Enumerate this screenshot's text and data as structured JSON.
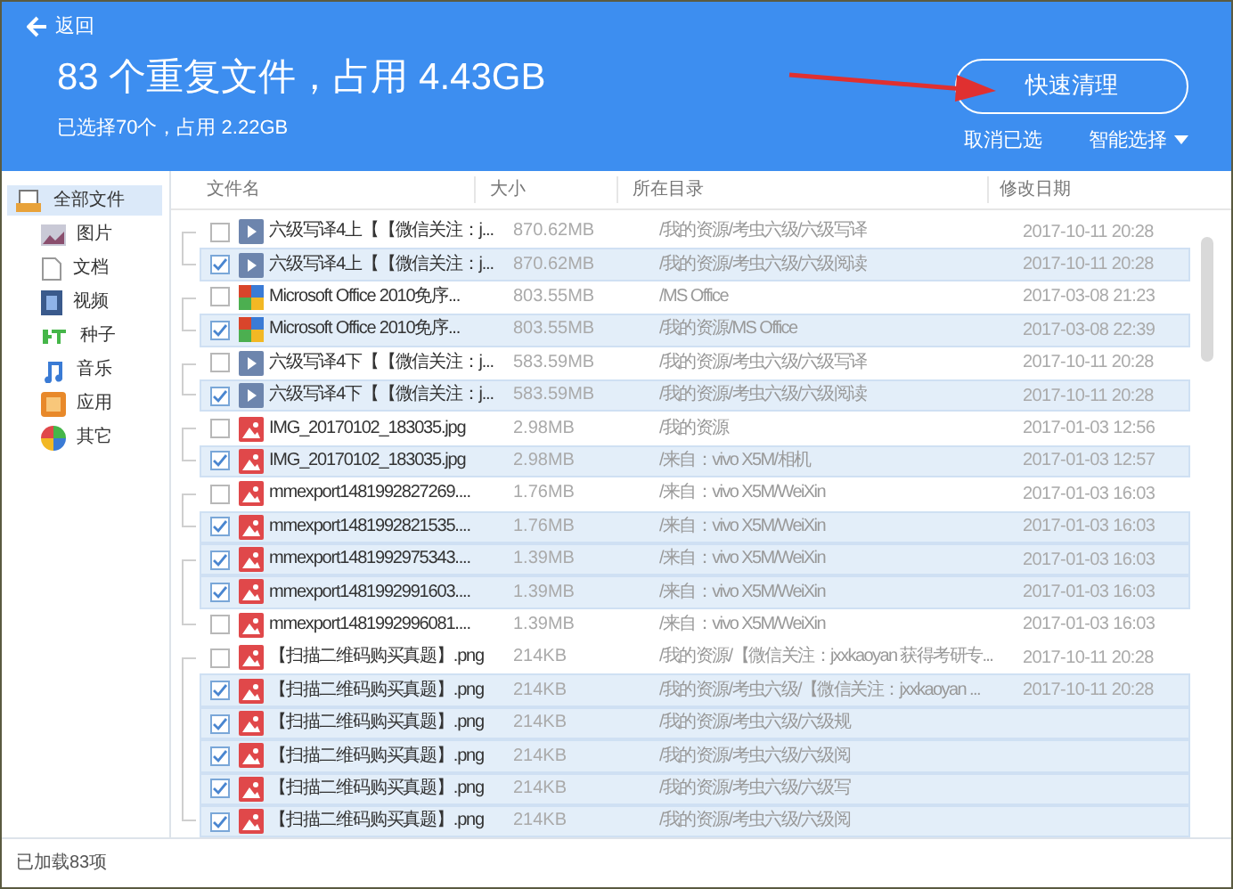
{
  "header": {
    "back": "返回",
    "title": "83 个重复文件，占用 4.43GB",
    "subtitle": "已选择70个，占用 2.22GB",
    "clean_button": "快速清理",
    "cancel_link": "取消已选",
    "smart_select": "智能选择"
  },
  "sidebar": {
    "items": [
      {
        "label": "全部文件",
        "kind": "all",
        "selected": true
      },
      {
        "label": "图片",
        "kind": "image",
        "selected": false
      },
      {
        "label": "文档",
        "kind": "doc",
        "selected": false
      },
      {
        "label": "视频",
        "kind": "video",
        "selected": false
      },
      {
        "label": "种子",
        "kind": "bt",
        "selected": false
      },
      {
        "label": "音乐",
        "kind": "music",
        "selected": false
      },
      {
        "label": "应用",
        "kind": "app",
        "selected": false
      },
      {
        "label": "其它",
        "kind": "other",
        "selected": false
      }
    ]
  },
  "table": {
    "columns": [
      "文件名",
      "大小",
      "所在目录",
      "修改日期"
    ],
    "groups": [
      {
        "rows": [
          {
            "name": "六级写译4上【【微信关注：j...",
            "kind": "video",
            "size": "870.62MB",
            "dir": "/我的资源/考虫六级/六级写译",
            "date": "2017-10-11 20:28",
            "checked": false
          },
          {
            "name": "六级写译4上【【微信关注：j...",
            "kind": "video",
            "size": "870.62MB",
            "dir": "/我的资源/考虫六级/六级阅读",
            "date": "2017-10-11 20:28",
            "checked": true
          }
        ]
      },
      {
        "rows": [
          {
            "name": "Microsoft Office 2010免序...",
            "kind": "app",
            "size": "803.55MB",
            "dir": "/MS Office",
            "date": "2017-03-08 21:23",
            "checked": false
          },
          {
            "name": "Microsoft Office 2010免序...",
            "kind": "app",
            "size": "803.55MB",
            "dir": "/我的资源/MS Office",
            "date": "2017-03-08 22:39",
            "checked": true
          }
        ]
      },
      {
        "rows": [
          {
            "name": "六级写译4下【【微信关注：j...",
            "kind": "video",
            "size": "583.59MB",
            "dir": "/我的资源/考虫六级/六级写译",
            "date": "2017-10-11 20:28",
            "checked": false
          },
          {
            "name": "六级写译4下【【微信关注：j...",
            "kind": "video",
            "size": "583.59MB",
            "dir": "/我的资源/考虫六级/六级阅读",
            "date": "2017-10-11 20:28",
            "checked": true
          }
        ]
      },
      {
        "rows": [
          {
            "name": "IMG_20170102_183035.jpg",
            "kind": "image",
            "size": "2.98MB",
            "dir": "/我的资源",
            "date": "2017-01-03 12:56",
            "checked": false
          },
          {
            "name": "IMG_20170102_183035.jpg",
            "kind": "image",
            "size": "2.98MB",
            "dir": "/来自：vivo X5M/相机",
            "date": "2017-01-03 12:57",
            "checked": true
          }
        ]
      },
      {
        "rows": [
          {
            "name": "mmexport1481992827269....",
            "kind": "image",
            "size": "1.76MB",
            "dir": "/来自：vivo X5M/WeiXin",
            "date": "2017-01-03 16:03",
            "checked": false
          },
          {
            "name": "mmexport1481992821535....",
            "kind": "image",
            "size": "1.76MB",
            "dir": "/来自：vivo X5M/WeiXin",
            "date": "2017-01-03 16:03",
            "checked": true
          }
        ]
      },
      {
        "rows": [
          {
            "name": "mmexport1481992975343....",
            "kind": "image",
            "size": "1.39MB",
            "dir": "/来自：vivo X5M/WeiXin",
            "date": "2017-01-03 16:03",
            "checked": true
          },
          {
            "name": "mmexport1481992991603....",
            "kind": "image",
            "size": "1.39MB",
            "dir": "/来自：vivo X5M/WeiXin",
            "date": "2017-01-03 16:03",
            "checked": true
          },
          {
            "name": "mmexport1481992996081....",
            "kind": "image",
            "size": "1.39MB",
            "dir": "/来自：vivo X5M/WeiXin",
            "date": "2017-01-03 16:03",
            "checked": false
          }
        ]
      },
      {
        "rows": [
          {
            "name": "【扫描二维码购买真题】.png",
            "kind": "image",
            "size": "214KB",
            "dir": "/我的资源/【微信关注：jxxkaoyan 获得考研专...",
            "date": "2017-10-11 20:28",
            "checked": false
          },
          {
            "name": "【扫描二维码购买真题】.png",
            "kind": "image",
            "size": "214KB",
            "dir": "/我的资源/考虫六级/【微信关注：jxxkaoyan ...",
            "date": "2017-10-11 20:28",
            "checked": true
          },
          {
            "name": "【扫描二维码购买真题】.png",
            "kind": "image",
            "size": "214KB",
            "dir": "/我的资源/考虫六级/六级规",
            "checked": true
          },
          {
            "name": "【扫描二维码购买真题】.png",
            "kind": "image",
            "size": "214KB",
            "dir": "/我的资源/考虫六级/六级阅",
            "checked": true
          },
          {
            "name": "【扫描二维码购买真题】.png",
            "kind": "image",
            "size": "214KB",
            "dir": "/我的资源/考虫六级/六级写",
            "checked": true
          },
          {
            "name": "【扫描二维码购买真题】.png",
            "kind": "image",
            "size": "214KB",
            "dir": "/我的资源/考虫六级/六级阅",
            "checked": true
          }
        ]
      }
    ]
  },
  "status_bar": "已加载83项"
}
